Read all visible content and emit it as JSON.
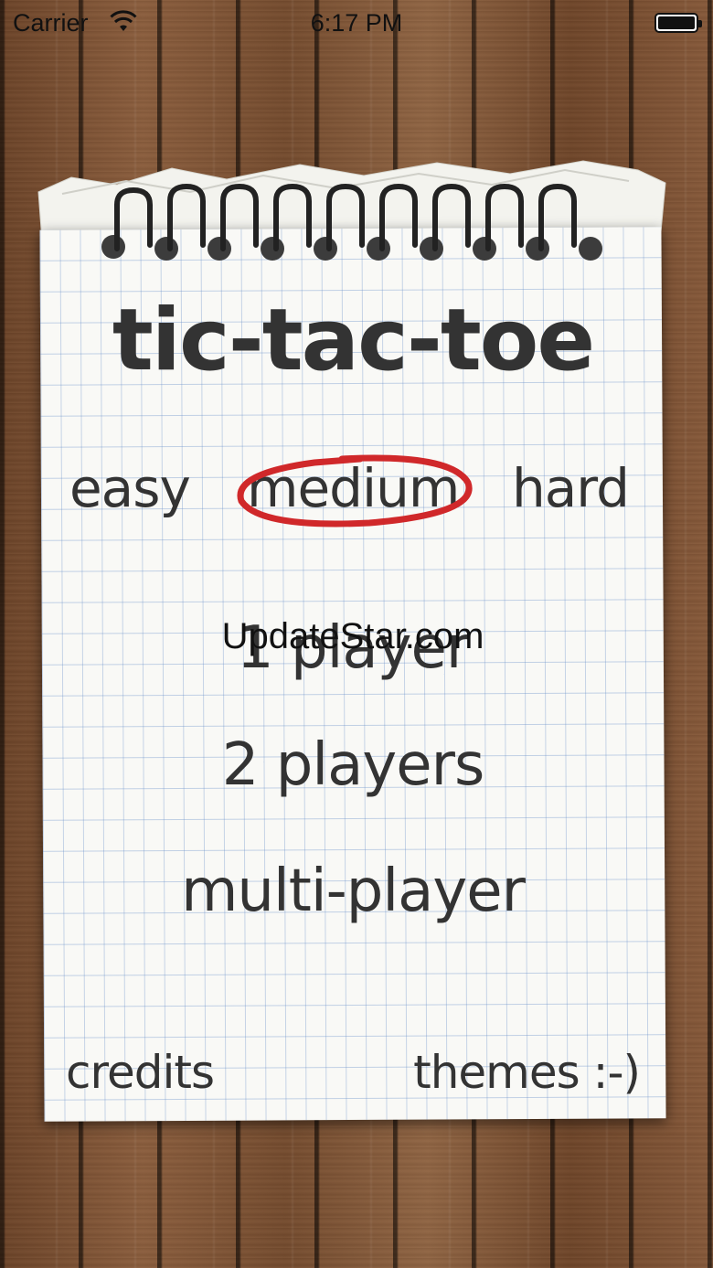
{
  "status_bar": {
    "carrier": "Carrier",
    "time": "6:17 PM",
    "wifi_icon": "wifi-icon",
    "battery_icon": "battery-icon"
  },
  "app": {
    "title": "tic-tac-toe",
    "difficulty": {
      "options": [
        "easy",
        "medium",
        "hard"
      ],
      "selected": "medium",
      "selection_color": "#d0282a"
    },
    "menu": {
      "one_player": "1 player",
      "two_players": "2 players",
      "multi_player": "multi-player"
    },
    "footer": {
      "credits": "credits",
      "themes": "themes :-)"
    }
  },
  "watermark": "UpdateStar.com"
}
